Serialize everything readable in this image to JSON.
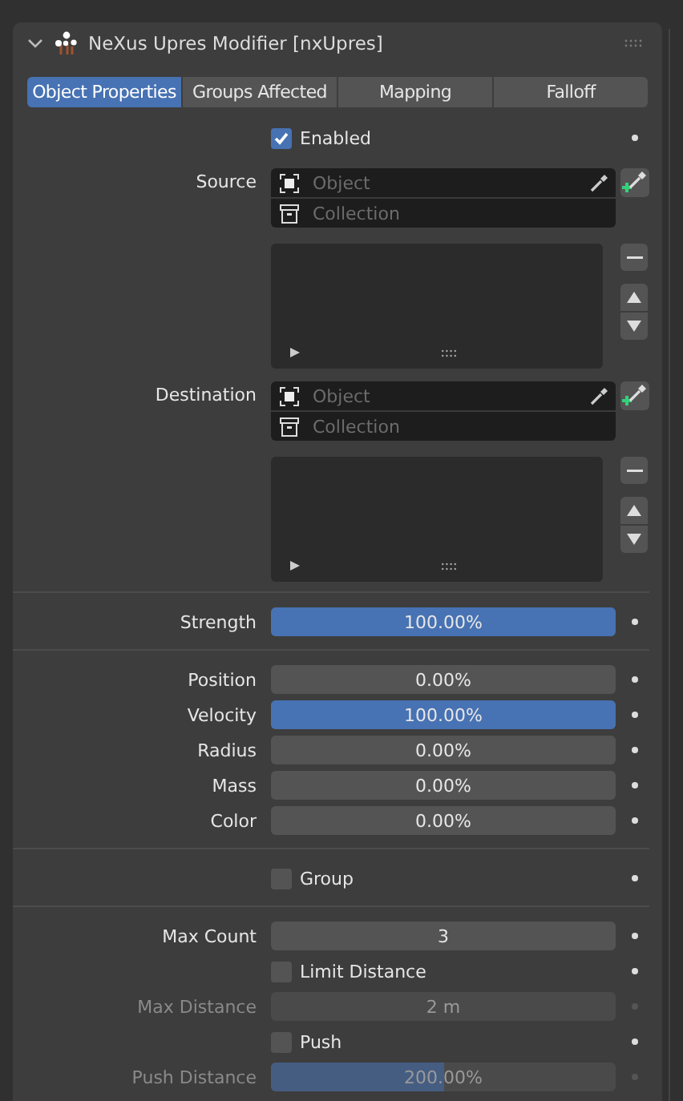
{
  "header": {
    "title": "NeXus Upres Modifier [nxUpres]"
  },
  "tabs": [
    {
      "label": "Object Properties",
      "selected": true
    },
    {
      "label": "Groups Affected",
      "selected": false
    },
    {
      "label": "Mapping",
      "selected": false
    },
    {
      "label": "Falloff",
      "selected": false
    }
  ],
  "rows": [
    {
      "kind": "checkbox",
      "label": "Enabled",
      "checked": true
    },
    {
      "kind": "picker",
      "label": "Source",
      "fields": [
        {
          "placeholder": "Object"
        },
        {
          "placeholder": "Collection"
        }
      ]
    },
    {
      "kind": "list"
    },
    {
      "kind": "picker",
      "label": "Destination",
      "fields": [
        {
          "placeholder": "Object"
        },
        {
          "placeholder": "Collection"
        }
      ]
    },
    {
      "kind": "list"
    },
    {
      "kind": "separator"
    },
    {
      "kind": "slider",
      "label": "Strength",
      "value": "100.00%",
      "level": 1,
      "disabled": false
    },
    {
      "kind": "separator"
    },
    {
      "kind": "slider",
      "label": "Position",
      "value": "0.00%",
      "disabled": false
    },
    {
      "kind": "slider",
      "label": "Velocity",
      "value": "100.00%",
      "level": 1,
      "disabled": false
    },
    {
      "kind": "slider",
      "label": "Radius",
      "value": "0.00%",
      "disabled": false
    },
    {
      "kind": "slider",
      "label": "Mass",
      "value": "0.00%",
      "disabled": false
    },
    {
      "kind": "slider",
      "label": "Color",
      "value": "0.00%",
      "disabled": false
    },
    {
      "kind": "separator"
    },
    {
      "kind": "checkbox",
      "label": "Group",
      "checked": false
    },
    {
      "kind": "separator"
    },
    {
      "kind": "number",
      "label": "Max Count",
      "value": "3",
      "disabled": false
    },
    {
      "kind": "checkbox",
      "label": "Limit Distance",
      "checked": false
    },
    {
      "kind": "number",
      "label": "Max Distance",
      "value": "2 m",
      "disabled": true
    },
    {
      "kind": "checkbox",
      "label": "Push",
      "checked": false
    },
    {
      "kind": "slider",
      "label": "Push Distance",
      "value": "200.00%",
      "level": 0.5,
      "disabled": true
    }
  ]
}
